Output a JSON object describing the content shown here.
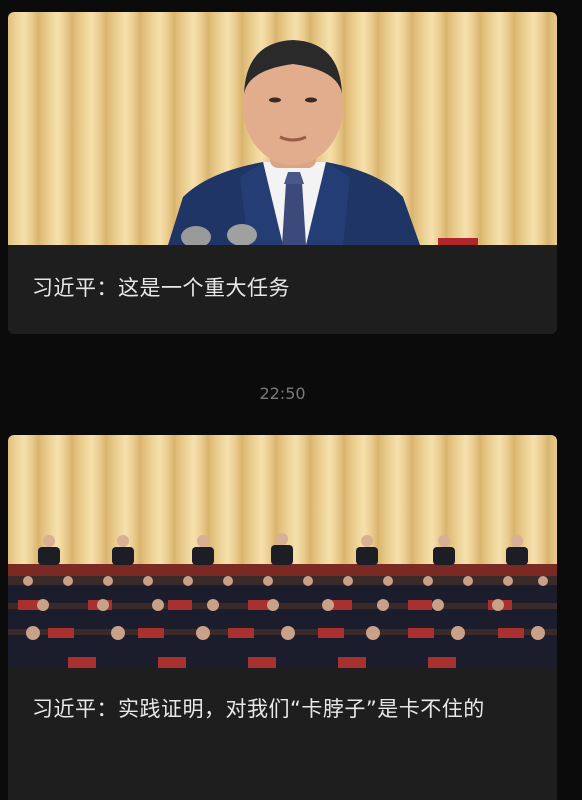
{
  "messages": [
    {
      "image_alt": "speaker-portrait-photo",
      "caption": "习近平：这是一个重大任务"
    },
    {
      "image_alt": "conference-hall-photo",
      "caption": "习近平：实践证明，对我们“卡脖子”是卡不住的"
    }
  ],
  "timestamp": "22:50",
  "colors": {
    "background": "#0b0b0b",
    "card": "#1e1e1e",
    "caption_text": "#e8e8e8",
    "timestamp_text": "#7a7a7a"
  }
}
